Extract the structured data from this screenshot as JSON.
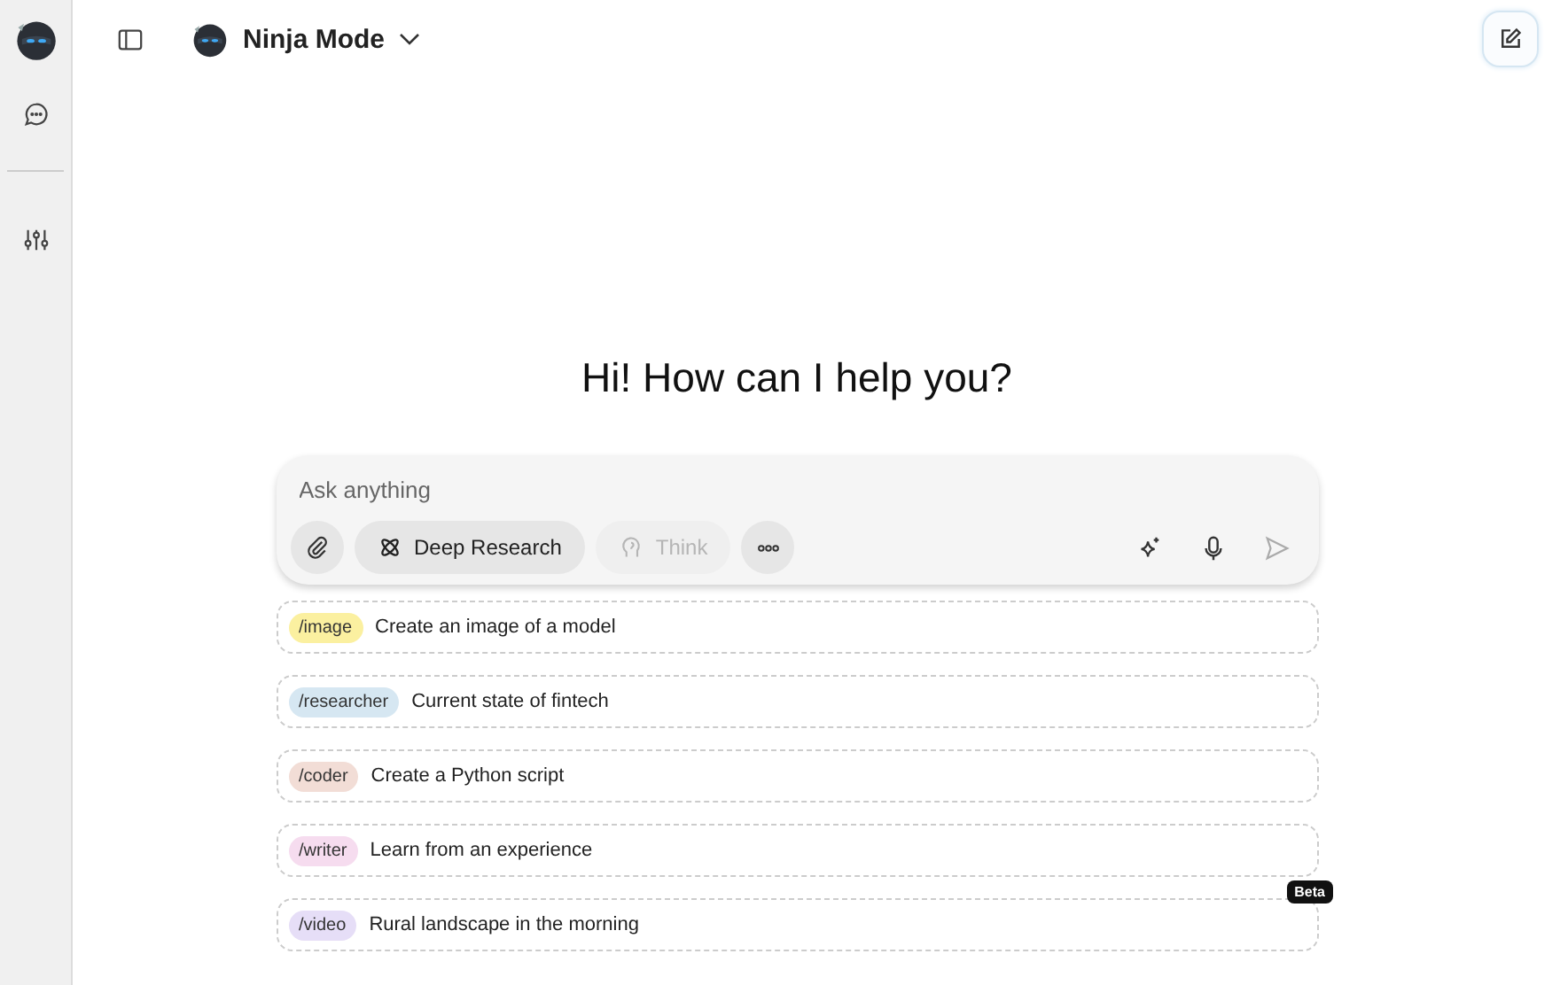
{
  "header": {
    "title": "Ninja Mode"
  },
  "greeting": "Hi! How can I help you?",
  "composer": {
    "placeholder": "Ask anything",
    "tools": [
      {
        "kind": "research",
        "label": "Deep Research",
        "disabled": false
      },
      {
        "kind": "think",
        "label": "Think",
        "disabled": true
      }
    ]
  },
  "suggestions": [
    {
      "tag": "/image",
      "text": "Create an image of a model",
      "color": "#fbf0a0"
    },
    {
      "tag": "/researcher",
      "text": "Current state of fintech",
      "color": "#d6e7f2"
    },
    {
      "tag": "/coder",
      "text": "Create a Python script",
      "color": "#f2ddd6"
    },
    {
      "tag": "/writer",
      "text": "Learn from an experience",
      "color": "#f6dcef"
    },
    {
      "tag": "/video",
      "text": "Rural landscape in the morning",
      "color": "#e6def7",
      "badge": "Beta"
    }
  ]
}
